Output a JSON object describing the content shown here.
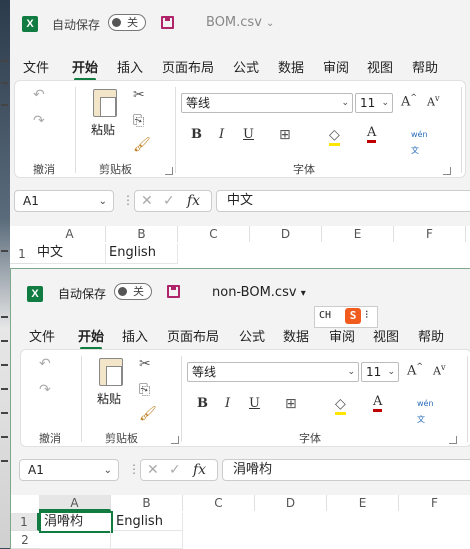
{
  "windows": [
    {
      "autosave_label": "自动保存",
      "toggle_label": "关",
      "filename": "BOM.csv",
      "filename_caret": "⌄",
      "menu": [
        "文件",
        "开始",
        "插入",
        "页面布局",
        "公式",
        "数据",
        "审阅",
        "视图",
        "帮助"
      ],
      "active_menu_index": 1,
      "groups": {
        "undo": "撤消",
        "clipboard": "剪贴板",
        "font": "字体"
      },
      "paste_label": "粘贴",
      "font_name": "等线",
      "font_size": "11",
      "font_buttons": [
        "B",
        "I",
        "U"
      ],
      "name_box": "A1",
      "formula": "中文",
      "fx": "fx",
      "columns": [
        "A",
        "B",
        "C",
        "D",
        "E",
        "F"
      ],
      "rows": [
        {
          "num": "1",
          "cells": [
            "中文",
            "English"
          ]
        }
      ]
    },
    {
      "autosave_label": "自动保存",
      "toggle_label": "关",
      "filename": "non-BOM.csv",
      "filename_caret": "▾",
      "menu": [
        "文件",
        "开始",
        "插入",
        "页面布局",
        "公式",
        "数据",
        "审阅",
        "视图",
        "帮助"
      ],
      "active_menu_index": 1,
      "groups": {
        "undo": "撤消",
        "clipboard": "剪贴板",
        "font": "字体"
      },
      "paste_label": "粘贴",
      "font_name": "等线",
      "font_size": "11",
      "font_buttons": [
        "B",
        "I",
        "U"
      ],
      "name_box": "A1",
      "formula": "涓嗗枃",
      "fx": "fx",
      "columns": [
        "A",
        "B",
        "C",
        "D",
        "E",
        "F"
      ],
      "rows": [
        {
          "num": "1",
          "cells": [
            "涓嗗枃",
            "English"
          ]
        },
        {
          "num": "2",
          "cells": [
            "",
            ""
          ]
        }
      ]
    }
  ],
  "ime": {
    "mode": "CH",
    "logo": "S"
  },
  "colors": {
    "excel_green": "#107c41",
    "save_icon": "#b0246a",
    "font_color_red": "#c00000",
    "highlight_yellow": "#ffe600"
  },
  "icons": [
    "excel-logo-icon",
    "save-icon",
    "undo-icon",
    "redo-icon",
    "cut-icon",
    "copy-icon",
    "format-painter-icon",
    "border-icon",
    "fill-color-icon",
    "font-color-icon",
    "phonetic-icon",
    "increase-font-icon",
    "decrease-font-icon",
    "cancel-icon",
    "enter-icon"
  ]
}
